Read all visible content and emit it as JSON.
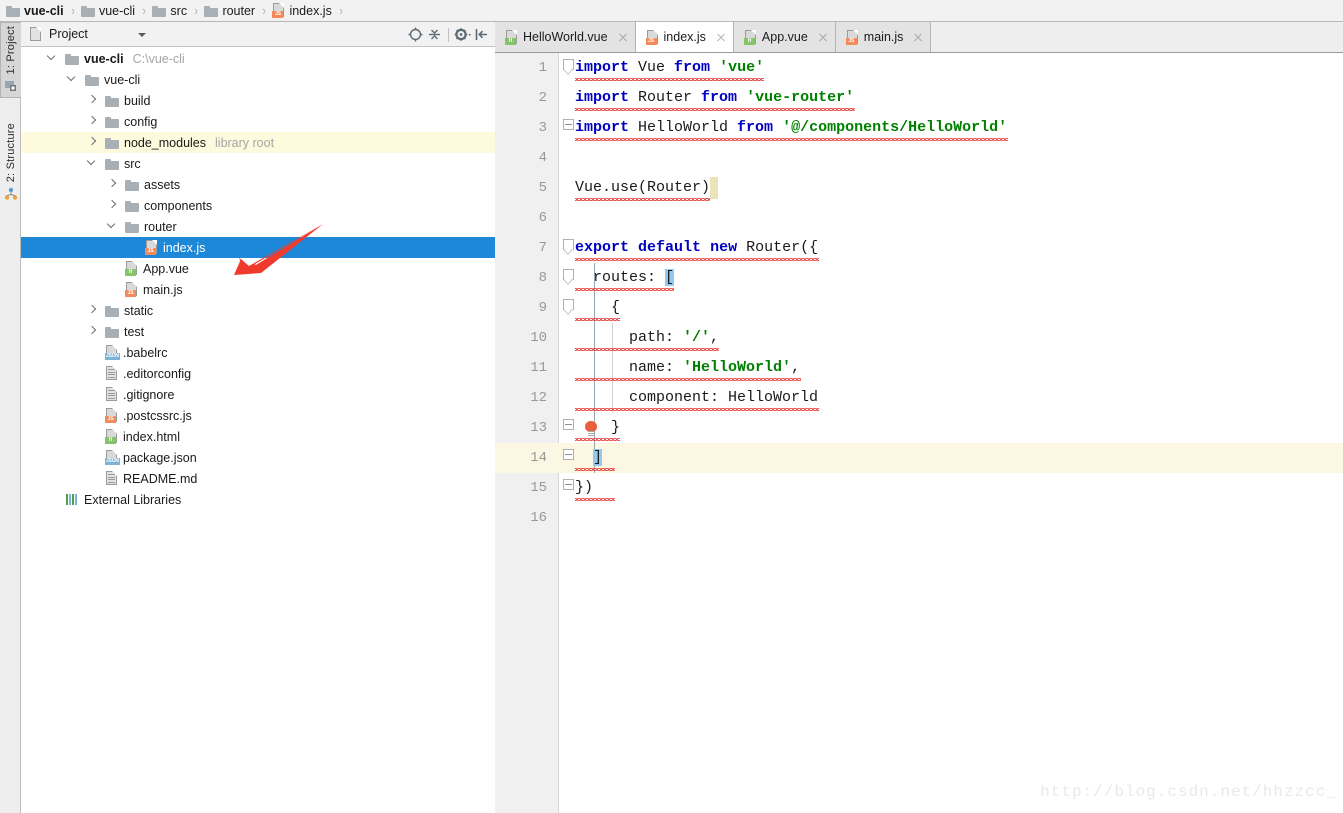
{
  "breadcrumb": {
    "items": [
      {
        "label": "vue-cli",
        "icon": "folder-icon",
        "bold": true
      },
      {
        "label": "vue-cli",
        "icon": "folder-icon",
        "bold": false
      },
      {
        "label": "src",
        "icon": "folder-icon",
        "bold": false
      },
      {
        "label": "router",
        "icon": "folder-icon",
        "bold": false
      },
      {
        "label": "index.js",
        "icon": "js-file-icon",
        "bold": false
      }
    ],
    "separator": "›"
  },
  "toolwindows": [
    {
      "label": "1: Project",
      "icon": "project-icon",
      "selected": true
    },
    {
      "label": "2: Structure",
      "icon": "structure-icon",
      "selected": false
    }
  ],
  "project_panel": {
    "title": "Project",
    "header_icons": [
      {
        "name": "locate-target-icon"
      },
      {
        "name": "collapse-all-icon"
      },
      {
        "name": "settings-gear-icon"
      },
      {
        "name": "hide-panel-icon"
      }
    ],
    "tree": [
      {
        "label": "vue-cli",
        "sub": "C:\\vue-cli",
        "icon": "folder-icon",
        "arrow": "down",
        "indent": 0,
        "bold": true,
        "selected": false,
        "library_root": false
      },
      {
        "label": "vue-cli",
        "sub": "",
        "icon": "folder-icon",
        "arrow": "down",
        "indent": 1,
        "bold": false,
        "selected": false,
        "library_root": false
      },
      {
        "label": "build",
        "sub": "",
        "icon": "folder-icon",
        "arrow": "right",
        "indent": 2,
        "bold": false,
        "selected": false,
        "library_root": false
      },
      {
        "label": "config",
        "sub": "",
        "icon": "folder-icon",
        "arrow": "right",
        "indent": 2,
        "bold": false,
        "selected": false,
        "library_root": false
      },
      {
        "label": "node_modules",
        "sub": "library root",
        "icon": "folder-icon",
        "arrow": "right",
        "indent": 2,
        "bold": false,
        "selected": false,
        "library_root": true
      },
      {
        "label": "src",
        "sub": "",
        "icon": "folder-icon",
        "arrow": "down",
        "indent": 2,
        "bold": false,
        "selected": false,
        "library_root": false
      },
      {
        "label": "assets",
        "sub": "",
        "icon": "folder-icon",
        "arrow": "right",
        "indent": 3,
        "bold": false,
        "selected": false,
        "library_root": false
      },
      {
        "label": "components",
        "sub": "",
        "icon": "folder-icon",
        "arrow": "right",
        "indent": 3,
        "bold": false,
        "selected": false,
        "library_root": false
      },
      {
        "label": "router",
        "sub": "",
        "icon": "folder-icon",
        "arrow": "down",
        "indent": 3,
        "bold": false,
        "selected": false,
        "library_root": false
      },
      {
        "label": "index.js",
        "sub": "",
        "icon": "js-file-icon",
        "arrow": "none",
        "indent": 4,
        "bold": false,
        "selected": true,
        "library_root": false
      },
      {
        "label": "App.vue",
        "sub": "",
        "icon": "vue-file-icon",
        "arrow": "none",
        "indent": 3,
        "bold": false,
        "selected": false,
        "library_root": false
      },
      {
        "label": "main.js",
        "sub": "",
        "icon": "js-file-icon",
        "arrow": "none",
        "indent": 3,
        "bold": false,
        "selected": false,
        "library_root": false
      },
      {
        "label": "static",
        "sub": "",
        "icon": "folder-icon",
        "arrow": "right",
        "indent": 2,
        "bold": false,
        "selected": false,
        "library_root": false
      },
      {
        "label": "test",
        "sub": "",
        "icon": "folder-icon",
        "arrow": "right",
        "indent": 2,
        "bold": false,
        "selected": false,
        "library_root": false
      },
      {
        "label": ".babelrc",
        "sub": "",
        "icon": "json-file-icon",
        "arrow": "none",
        "indent": 2,
        "bold": false,
        "selected": false,
        "library_root": false
      },
      {
        "label": ".editorconfig",
        "sub": "",
        "icon": "text-file-icon",
        "arrow": "none",
        "indent": 2,
        "bold": false,
        "selected": false,
        "library_root": false
      },
      {
        "label": ".gitignore",
        "sub": "",
        "icon": "text-file-icon",
        "arrow": "none",
        "indent": 2,
        "bold": false,
        "selected": false,
        "library_root": false
      },
      {
        "label": ".postcssrc.js",
        "sub": "",
        "icon": "js-file-icon",
        "arrow": "none",
        "indent": 2,
        "bold": false,
        "selected": false,
        "library_root": false
      },
      {
        "label": "index.html",
        "sub": "",
        "icon": "html-file-icon",
        "arrow": "none",
        "indent": 2,
        "bold": false,
        "selected": false,
        "library_root": false
      },
      {
        "label": "package.json",
        "sub": "",
        "icon": "json-file-icon",
        "arrow": "none",
        "indent": 2,
        "bold": false,
        "selected": false,
        "library_root": false
      },
      {
        "label": "README.md",
        "sub": "",
        "icon": "text-file-icon",
        "arrow": "none",
        "indent": 2,
        "bold": false,
        "selected": false,
        "library_root": false
      },
      {
        "label": "External Libraries",
        "sub": "",
        "icon": "libraries-icon",
        "arrow": "none",
        "indent": 0,
        "bold": false,
        "selected": false,
        "library_root": false
      }
    ]
  },
  "editor": {
    "tabs": [
      {
        "label": "HelloWorld.vue",
        "icon": "vue-file-icon",
        "active": false
      },
      {
        "label": "index.js",
        "icon": "js-file-icon",
        "active": true
      },
      {
        "label": "App.vue",
        "icon": "vue-file-icon",
        "active": false
      },
      {
        "label": "main.js",
        "icon": "js-file-icon",
        "active": false
      }
    ],
    "caret_line": 14,
    "lines": [
      {
        "n": "1",
        "tokens": [
          {
            "t": "import",
            "c": "kw"
          },
          {
            "t": " Vue ",
            "c": "plain"
          },
          {
            "t": "from",
            "c": "kw"
          },
          {
            "t": " ",
            "c": "plain"
          },
          {
            "t": "'vue'",
            "c": "str"
          }
        ]
      },
      {
        "n": "2",
        "tokens": [
          {
            "t": "import",
            "c": "kw"
          },
          {
            "t": " Router ",
            "c": "plain"
          },
          {
            "t": "from",
            "c": "kw"
          },
          {
            "t": " ",
            "c": "plain"
          },
          {
            "t": "'vue-router'",
            "c": "str"
          }
        ]
      },
      {
        "n": "3",
        "tokens": [
          {
            "t": "import",
            "c": "kw"
          },
          {
            "t": " HelloWorld ",
            "c": "plain"
          },
          {
            "t": "from",
            "c": "kw"
          },
          {
            "t": " ",
            "c": "plain"
          },
          {
            "t": "'@/components/HelloWorld'",
            "c": "str"
          }
        ]
      },
      {
        "n": "4",
        "tokens": []
      },
      {
        "n": "5",
        "tokens": [
          {
            "t": "Vue.use(Router)",
            "c": "plain"
          }
        ]
      },
      {
        "n": "6",
        "tokens": []
      },
      {
        "n": "7",
        "tokens": [
          {
            "t": "export",
            "c": "kw"
          },
          {
            "t": " ",
            "c": "plain"
          },
          {
            "t": "default",
            "c": "kw"
          },
          {
            "t": " ",
            "c": "plain"
          },
          {
            "t": "new",
            "c": "kw"
          },
          {
            "t": " Router({",
            "c": "plain"
          }
        ]
      },
      {
        "n": "8",
        "tokens": [
          {
            "t": "  routes: ",
            "c": "plain"
          },
          {
            "t": "[",
            "c": "brkt"
          }
        ]
      },
      {
        "n": "9",
        "tokens": [
          {
            "t": "    {",
            "c": "plain"
          }
        ]
      },
      {
        "n": "10",
        "tokens": [
          {
            "t": "      path: ",
            "c": "plain"
          },
          {
            "t": "'/'",
            "c": "str"
          },
          {
            "t": ",",
            "c": "plain"
          }
        ]
      },
      {
        "n": "11",
        "tokens": [
          {
            "t": "      name: ",
            "c": "plain"
          },
          {
            "t": "'HelloWorld'",
            "c": "str"
          },
          {
            "t": ",",
            "c": "plain"
          }
        ]
      },
      {
        "n": "12",
        "tokens": [
          {
            "t": "      component: HelloWorld",
            "c": "plain"
          }
        ]
      },
      {
        "n": "13",
        "tokens": [
          {
            "t": "    }",
            "c": "plain"
          }
        ]
      },
      {
        "n": "14",
        "tokens": [
          {
            "t": "  ",
            "c": "plain"
          },
          {
            "t": "]",
            "c": "brkt"
          }
        ]
      },
      {
        "n": "15",
        "tokens": [
          {
            "t": "})",
            "c": "plain"
          }
        ]
      },
      {
        "n": "16",
        "tokens": []
      }
    ]
  },
  "watermark": "http://blog.csdn.net/hhzzcc_",
  "colors": {
    "selection_blue": "#1e88d8",
    "library_root_yellow": "#fdfade",
    "caret_line": "#fcf7e3",
    "keyword": "#0000c0",
    "string": "#008000",
    "bracket_match": "#93c9f0",
    "error_squiggle": "#e53935",
    "annotation_arrow": "#f03a2e"
  }
}
